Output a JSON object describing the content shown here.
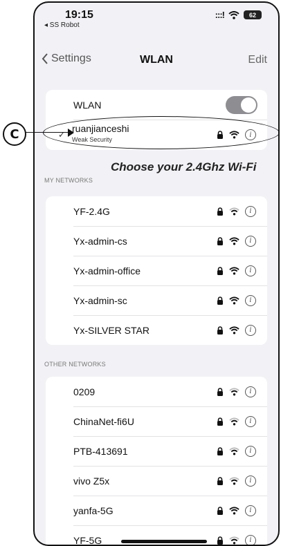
{
  "status_bar": {
    "time": "19:15",
    "carrier": "◂ SS Robot",
    "signal": ":::!",
    "battery": "62"
  },
  "nav": {
    "back_label": "Settings",
    "title": "WLAN",
    "edit_label": "Edit"
  },
  "wlan_toggle": {
    "label": "WLAN",
    "on": true
  },
  "connected": {
    "name": "ruanjianceshi",
    "subtitle": "Weak Security"
  },
  "annotation": {
    "marker": "C",
    "hint": "Choose your 2.4Ghz Wi-Fi"
  },
  "my_networks": {
    "header": "MY NETWORKS",
    "items": [
      {
        "label": "YF-2.4G"
      },
      {
        "label": "Yx-admin-cs"
      },
      {
        "label": "Yx-admin-office"
      },
      {
        "label": "Yx-admin-sc"
      },
      {
        "label": "Yx-SILVER STAR"
      }
    ]
  },
  "other_networks": {
    "header": "OTHER NETWORKS",
    "items": [
      {
        "label": "0209"
      },
      {
        "label": "ChinaNet-fi6U"
      },
      {
        "label": "PTB-413691"
      },
      {
        "label": "vivo Z5x"
      },
      {
        "label": "yanfa-5G"
      },
      {
        "label": "YF-5G"
      }
    ]
  },
  "icons": {
    "lock": "lock-icon",
    "wifi": "wifi-icon",
    "info": "info-icon"
  },
  "colors": {
    "toggle_off_gray": "#8e8e92",
    "background": "#f2f2f6"
  }
}
